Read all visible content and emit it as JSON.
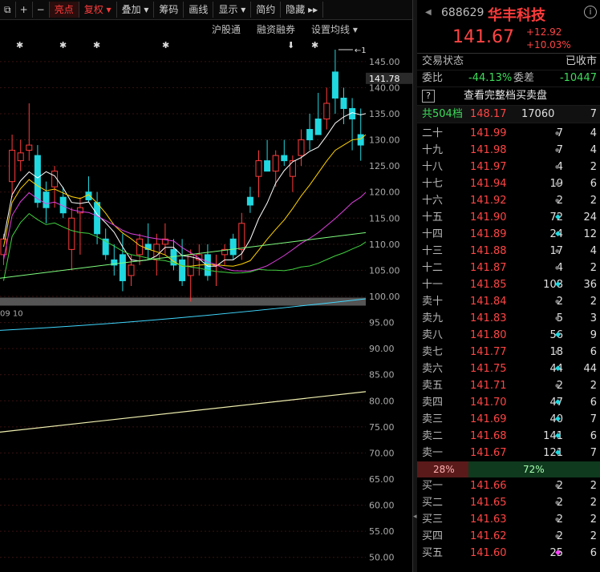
{
  "toolbar": {
    "items": [
      "⧉",
      "+",
      "−",
      "亮点",
      "复权 ▾",
      "叠加 ▾",
      "筹码",
      "画线",
      "显示 ▾",
      "简约",
      "隐藏 ▸▸"
    ]
  },
  "subtoolbar": {
    "hkconnect": "沪股通",
    "margin": "融资融券",
    "ma_setting": "设置均线 ▾"
  },
  "chart_data": {
    "type": "candlestick",
    "y_ticks": [
      "145.00",
      "140.00",
      "135.00",
      "130.00",
      "125.00",
      "120.00",
      "115.00",
      "110.00",
      "105.00",
      "100.00",
      "95.00",
      "90.00",
      "85.00",
      "80.00",
      "75.00",
      "70.00",
      "65.00",
      "60.00",
      "55.00",
      "50.00"
    ],
    "ylim": [
      47.5,
      148.2
    ],
    "high_marker": "147.28",
    "last_price_label": "141.78",
    "date_label": "09 10",
    "candles": [
      {
        "o": 108,
        "h": 112,
        "l": 106,
        "c": 111
      },
      {
        "o": 122,
        "h": 131,
        "l": 119,
        "c": 128
      },
      {
        "o": 126,
        "h": 130,
        "l": 124,
        "c": 127.5
      },
      {
        "o": 128,
        "h": 137,
        "l": 126,
        "c": 129
      },
      {
        "o": 127,
        "h": 129,
        "l": 117,
        "c": 118
      },
      {
        "o": 120,
        "h": 122,
        "l": 114,
        "c": 117
      },
      {
        "o": 121,
        "h": 125,
        "l": 117,
        "c": 124
      },
      {
        "o": 119,
        "h": 121,
        "l": 115,
        "c": 116
      },
      {
        "o": 109,
        "h": 117,
        "l": 105,
        "c": 115
      },
      {
        "o": 116,
        "h": 119,
        "l": 108,
        "c": 117
      },
      {
        "o": 120,
        "h": 123,
        "l": 118,
        "c": 118.5
      },
      {
        "o": 118,
        "h": 120,
        "l": 110,
        "c": 112
      },
      {
        "o": 111,
        "h": 113,
        "l": 107,
        "c": 108
      },
      {
        "o": 107,
        "h": 110,
        "l": 104,
        "c": 106
      },
      {
        "o": 108,
        "h": 112,
        "l": 101,
        "c": 103
      },
      {
        "o": 104,
        "h": 108,
        "l": 102,
        "c": 106
      },
      {
        "o": 108,
        "h": 112,
        "l": 106,
        "c": 111
      },
      {
        "o": 110,
        "h": 114,
        "l": 107,
        "c": 109
      },
      {
        "o": 107,
        "h": 112,
        "l": 104,
        "c": 110
      },
      {
        "o": 110,
        "h": 114,
        "l": 108,
        "c": 111
      },
      {
        "o": 109,
        "h": 111,
        "l": 105,
        "c": 106
      },
      {
        "o": 107,
        "h": 111,
        "l": 102,
        "c": 103
      },
      {
        "o": 104,
        "h": 109,
        "l": 99,
        "c": 108
      },
      {
        "o": 107,
        "h": 110,
        "l": 104,
        "c": 108
      },
      {
        "o": 108,
        "h": 110,
        "l": 103,
        "c": 104
      },
      {
        "o": 106,
        "h": 108,
        "l": 102,
        "c": 106
      },
      {
        "o": 108,
        "h": 110,
        "l": 106,
        "c": 109
      },
      {
        "o": 111,
        "h": 112,
        "l": 107,
        "c": 108
      },
      {
        "o": 109,
        "h": 116,
        "l": 107,
        "c": 114
      },
      {
        "o": 119,
        "h": 121,
        "l": 116,
        "c": 117.5
      },
      {
        "o": 123,
        "h": 128,
        "l": 119,
        "c": 126
      },
      {
        "o": 126,
        "h": 130,
        "l": 124,
        "c": 124
      },
      {
        "o": 124,
        "h": 128,
        "l": 121,
        "c": 127
      },
      {
        "o": 127,
        "h": 130,
        "l": 125,
        "c": 126
      },
      {
        "o": 123,
        "h": 127,
        "l": 120,
        "c": 126
      },
      {
        "o": 127,
        "h": 132,
        "l": 125,
        "c": 130
      },
      {
        "o": 132,
        "h": 135,
        "l": 128,
        "c": 130
      },
      {
        "o": 134,
        "h": 139,
        "l": 131,
        "c": 131
      },
      {
        "o": 134,
        "h": 140,
        "l": 132,
        "c": 137
      },
      {
        "o": 143,
        "h": 147.28,
        "l": 135,
        "c": 138
      },
      {
        "o": 138,
        "h": 140,
        "l": 133,
        "c": 136
      },
      {
        "o": 136,
        "h": 138,
        "l": 128,
        "c": 134
      },
      {
        "o": 131,
        "h": 136,
        "l": 126,
        "c": 129
      },
      {
        "o": 129,
        "h": 142,
        "l": 125,
        "c": 139
      },
      {
        "o": 139,
        "h": 142,
        "l": 125,
        "c": 141.67
      }
    ]
  },
  "quote": {
    "code": "688629",
    "name": "华丰科技",
    "price": "141.67",
    "change": "+12.92",
    "change_pct": "+10.03%",
    "status_label": "交易状态",
    "status_value": "已收市",
    "weibi_label": "委比",
    "weibi_value": "-44.13%",
    "weicha_label": "委差",
    "weicha_value": "-10447",
    "full_book_icon": "?",
    "full_book": "查看完整档买卖盘",
    "total_label": "共504档",
    "total_price": "148.17",
    "total_vol": "17060",
    "total_cnt": "7",
    "sell_ratio": "28%",
    "buy_ratio": "72%",
    "asks": [
      {
        "label": "二十",
        "price": "141.99",
        "vol": "7",
        "dot": "gray",
        "cnt": "4"
      },
      {
        "label": "十九",
        "price": "141.98",
        "vol": "7",
        "dot": "gray",
        "cnt": "4"
      },
      {
        "label": "十八",
        "price": "141.97",
        "vol": "4",
        "dot": "gray",
        "cnt": "2"
      },
      {
        "label": "十七",
        "price": "141.94",
        "vol": "19",
        "dot": "gray",
        "cnt": "6"
      },
      {
        "label": "十六",
        "price": "141.92",
        "vol": "2",
        "dot": "gray",
        "cnt": "2"
      },
      {
        "label": "十五",
        "price": "141.90",
        "vol": "72",
        "dot": "cyan",
        "cnt": "24"
      },
      {
        "label": "十四",
        "price": "141.89",
        "vol": "24",
        "dot": "cyan",
        "cnt": "12"
      },
      {
        "label": "十三",
        "price": "141.88",
        "vol": "17",
        "dot": "gray",
        "cnt": "4"
      },
      {
        "label": "十二",
        "price": "141.87",
        "vol": "4",
        "dot": "gray",
        "cnt": "2"
      },
      {
        "label": "十一",
        "price": "141.85",
        "vol": "108",
        "dot": "cyan",
        "cnt": "36"
      },
      {
        "label": "卖十",
        "price": "141.84",
        "vol": "2",
        "dot": "gray",
        "cnt": "2"
      },
      {
        "label": "卖九",
        "price": "141.83",
        "vol": "5",
        "dot": "gray",
        "cnt": "3"
      },
      {
        "label": "卖八",
        "price": "141.80",
        "vol": "56",
        "dot": "cyan",
        "cnt": "9"
      },
      {
        "label": "卖七",
        "price": "141.77",
        "vol": "18",
        "dot": "gray",
        "cnt": "6"
      },
      {
        "label": "卖六",
        "price": "141.75",
        "vol": "44",
        "dot": "cyan",
        "cnt": "44"
      },
      {
        "label": "卖五",
        "price": "141.71",
        "vol": "2",
        "dot": "gray",
        "cnt": "2"
      },
      {
        "label": "卖四",
        "price": "141.70",
        "vol": "47",
        "dot": "cyan",
        "cnt": "6"
      },
      {
        "label": "卖三",
        "price": "141.69",
        "vol": "40",
        "dot": "cyan",
        "cnt": "7"
      },
      {
        "label": "卖二",
        "price": "141.68",
        "vol": "141",
        "dot": "cyan",
        "cnt": "6"
      },
      {
        "label": "卖一",
        "price": "141.67",
        "vol": "121",
        "dot": "cyan",
        "cnt": "7"
      }
    ],
    "bids": [
      {
        "label": "买一",
        "price": "141.66",
        "vol": "2",
        "dot": "gray",
        "cnt": "2"
      },
      {
        "label": "买二",
        "price": "141.65",
        "vol": "2",
        "dot": "gray",
        "cnt": "2"
      },
      {
        "label": "买三",
        "price": "141.63",
        "vol": "2",
        "dot": "gray",
        "cnt": "2"
      },
      {
        "label": "买四",
        "price": "141.62",
        "vol": "2",
        "dot": "gray",
        "cnt": "2"
      },
      {
        "label": "买五",
        "price": "141.60",
        "vol": "25",
        "dot": "magenta",
        "cnt": "6"
      }
    ]
  },
  "colors": {
    "up": "#ff3b3b",
    "down": "#20d8e0",
    "ma5": "#ffffff",
    "ma10": "#ffd200",
    "ma20": "#e040e0",
    "ma30": "#40d040",
    "ma60": "#7fff7f",
    "ma120": "#40d8ff",
    "ma250": "#f0f0b0"
  }
}
